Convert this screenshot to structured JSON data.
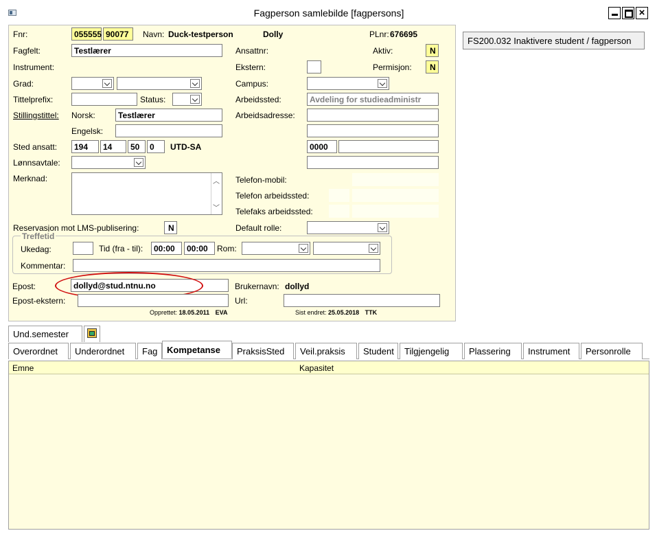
{
  "window": {
    "title": "Fagperson samlebilde  [fagpersons]"
  },
  "right_button": "FS200.032 Inaktivere student / fagperson",
  "form": {
    "fnr_label": "Fnr:",
    "fnr_part1": "055555",
    "fnr_part2": "90077",
    "navn_label": "Navn:",
    "navn_last": "Duck-testperson",
    "navn_first": "Dolly",
    "plnr_label": "PLnr:",
    "plnr_value": "676695",
    "fagfelt_label": "Fagfelt:",
    "fagfelt_value": "Testlærer",
    "ansattnr_label": "Ansattnr:",
    "aktiv_label": "Aktiv:",
    "aktiv_value": "N",
    "instrument_label": "Instrument:",
    "ekstern_label": "Ekstern:",
    "permisjon_label": "Permisjon:",
    "permisjon_value": "N",
    "grad_label": "Grad:",
    "campus_label": "Campus:",
    "tittelprefix_label": "Tittelprefix:",
    "status_label": "Status:",
    "arbeidssted_label": "Arbeidssted:",
    "arbeidssted_value": "Avdeling for studieadministr",
    "stillingstittel_label": "Stillingstittel:",
    "norsk_label": "Norsk:",
    "norsk_value": "Testlærer",
    "arbeidsadresse_label": "Arbeidsadresse:",
    "engelsk_label": "Engelsk:",
    "sted_ansatt_label": "Sted ansatt:",
    "sted_1": "194",
    "sted_2": "14",
    "sted_3": "50",
    "sted_4": "0",
    "sted_kode": "UTD-SA",
    "postnr_value": "0000",
    "lonnsavtale_label": "Lønnsavtale:",
    "merknad_label": "Merknad:",
    "telefon_mobil_label": "Telefon-mobil:",
    "telefon_arbeidssted_label": "Telefon arbeidssted:",
    "telefaks_arbeidssted_label": "Telefaks arbeidssted:",
    "reservasjon_label": "Reservasjon mot LMS-publisering:",
    "reservasjon_value": "N",
    "default_rolle_label": "Default rolle:",
    "treffetid_label": "Treffetid",
    "ukedag_label": "Ukedag:",
    "tid_label": "Tid (fra - til):",
    "tid_fra": "00:00",
    "tid_til": "00:00",
    "rom_label": "Rom:",
    "kommentar_label": "Kommentar:",
    "epost_label": "Epost:",
    "epost_value": "dollyd@stud.ntnu.no",
    "brukernavn_label": "Brukernavn:",
    "brukernavn_value": "dollyd",
    "epost_ekstern_label": "Epost-ekstern:",
    "url_label": "Url:",
    "opprettet_label": "Opprettet:",
    "opprettet_date": "18.05.2011",
    "opprettet_by": "EVA",
    "sist_endret_label": "Sist endret:",
    "sist_endret_date": "25.05.2018",
    "sist_endret_by": "TTK"
  },
  "tabs_top": [
    "Und.semester"
  ],
  "tabs": [
    "Overordnet",
    "Underordnet",
    "Fag",
    "Kompetanse",
    "PraksisSted",
    "Veil.praksis",
    "Student",
    "Tilgjengelig",
    "Plassering",
    "Instrument",
    "Personrolle"
  ],
  "active_tab": "Kompetanse",
  "grid": {
    "columns": [
      "Emne",
      "Kapasitet"
    ]
  },
  "colors": {
    "form_bg": "#fffde0",
    "highlight_yellow": "#ffff99",
    "annotation": "#d01010"
  }
}
